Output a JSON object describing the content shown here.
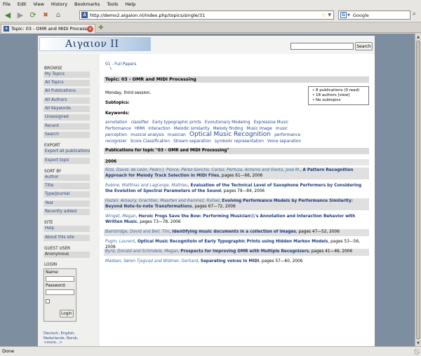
{
  "menu": [
    "File",
    "Edit",
    "View",
    "History",
    "Bookmarks",
    "Tools",
    "Help"
  ],
  "browser": {
    "url": "http://demo2.aigaion.nl/index.php/topics/single/31",
    "search_engine": "Google",
    "tab_title": "Topic: 03 - OMR and MIDI Processing - ...",
    "status": "Done"
  },
  "site": {
    "logo": "Αιγαιον II",
    "search_button": "Search"
  },
  "sidebar": {
    "browse_head": "BROWSE",
    "browse": [
      "My Topics",
      "All Topics",
      "All Publications",
      "All Authors",
      "All Keywords",
      "Unassigned",
      "Recent",
      "Search"
    ],
    "export_head": "EXPORT",
    "export": [
      "Export all publications",
      "Export topic"
    ],
    "sort_head": "SORT BY",
    "sort": [
      "Author",
      "Title",
      "Type/Journal",
      "Year",
      "Recently added"
    ],
    "site_head": "SITE",
    "site": [
      "Help",
      "About this site"
    ],
    "guest_head": "GUEST USER",
    "guest_name": "Anonymous",
    "login_head": "LOGIN",
    "login_name_label": "Name:",
    "login_password_label": "Password:",
    "login_button": "Login",
    "languages": "Deutsch, English, Nederlands, Norsk, <more...>"
  },
  "content": {
    "breadcrumb": "01 - Full Papers",
    "breadcrumb_sub": "└",
    "topic_title": "Topic: 03 - OMR and MIDI Processing",
    "description": "Monday, third session.",
    "info": [
      "8 publications (0 read)",
      "18 authors [view]",
      "No subtopics"
    ],
    "subtopics_label": "Subtopics:",
    "keywords_label": "Keywords:",
    "publications_head": "Publications for topic \"03 - OMR and MIDI Processing\"",
    "year": "2006"
  },
  "keywords": [
    {
      "t": "annotation",
      "s": 5.8
    },
    {
      "t": "classifier",
      "s": 5.8
    },
    {
      "t": "Early typographic prints",
      "s": 5.8
    },
    {
      "t": "Evolutionary Modeling",
      "s": 5.8
    },
    {
      "t": "Expressive Music Performance",
      "s": 5.8
    },
    {
      "t": "HMM",
      "s": 5.8
    },
    {
      "t": "interaction",
      "s": 5.8
    },
    {
      "t": "Melodic similarity",
      "s": 5.8
    },
    {
      "t": "Melody finding",
      "s": 5.8
    },
    {
      "t": "Music Image",
      "s": 5.8
    },
    {
      "t": "music perception",
      "s": 5.8
    },
    {
      "t": "musical analysis",
      "s": 5.8
    },
    {
      "t": "musician",
      "s": 5.8
    },
    {
      "t": "Optical Music Recognition",
      "s": 9
    },
    {
      "t": "performance",
      "s": 5.8
    },
    {
      "t": "recognizer",
      "s": 5.8
    },
    {
      "t": "Score Classification",
      "s": 5.8
    },
    {
      "t": "Stream separation",
      "s": 5.8
    },
    {
      "t": "symbolic representation",
      "s": 5.8
    },
    {
      "t": "Voice separation",
      "s": 5.8
    }
  ],
  "publications": [
    {
      "authors": "Rizo, David, de León, Pedro J. Ponce, Pérez-Sancho, Carlos, Pertusa, Antonio and Iñesta, José M.",
      "title": "A Pattern Recognition Approach for Melody Track Selection in MIDI Files",
      "pages": ", pages 61—66, 2006"
    },
    {
      "authors": "Robine, Matthias and Lagrange, Mathieu",
      "title": "Evaluation of the Technical Level of Saxophone Performers by Considering the Evolution of Spectral Parameters of the Sound",
      "pages": ", pages 79—84, 2006"
    },
    {
      "authors": "Hazan, Amaury, Grachten, Maarten and Ramirez, Rafael",
      "title": "Evolving Performance Models by Performance Similarity: Beyond Note-to-note Transformations",
      "pages": ", pages 67—72, 2006"
    },
    {
      "authors": "Winget, Megan",
      "title": "Heroic Frogs Save the Bow: Performing Musician\\\\\\'s Annotation and Interaction Behavior with Written Music",
      "pages": ", pages 73—78, 2006"
    },
    {
      "authors": "Bainbridge, David and Bell, Tim",
      "title": "Identifying music documents in a collection of images",
      "pages": ", pages 47—52, 2006"
    },
    {
      "authors": "Pugin, Laurent",
      "title": "Optical Music Recognitoin of Early Typographic Prints using Hidden Markov Models",
      "pages": ", pages 53—56, 2006"
    },
    {
      "authors": "Byrd, Donald and Schindele, Megan",
      "title": "Prospects for Improving OMR with Multiple Recognizers",
      "pages": ", pages 41—46, 2006"
    },
    {
      "authors": "Madsen, Søren Tjagvad and Widmer, Gerhard",
      "title": "Separating voices in MIDI",
      "pages": ", pages 57—60, 2006"
    }
  ]
}
